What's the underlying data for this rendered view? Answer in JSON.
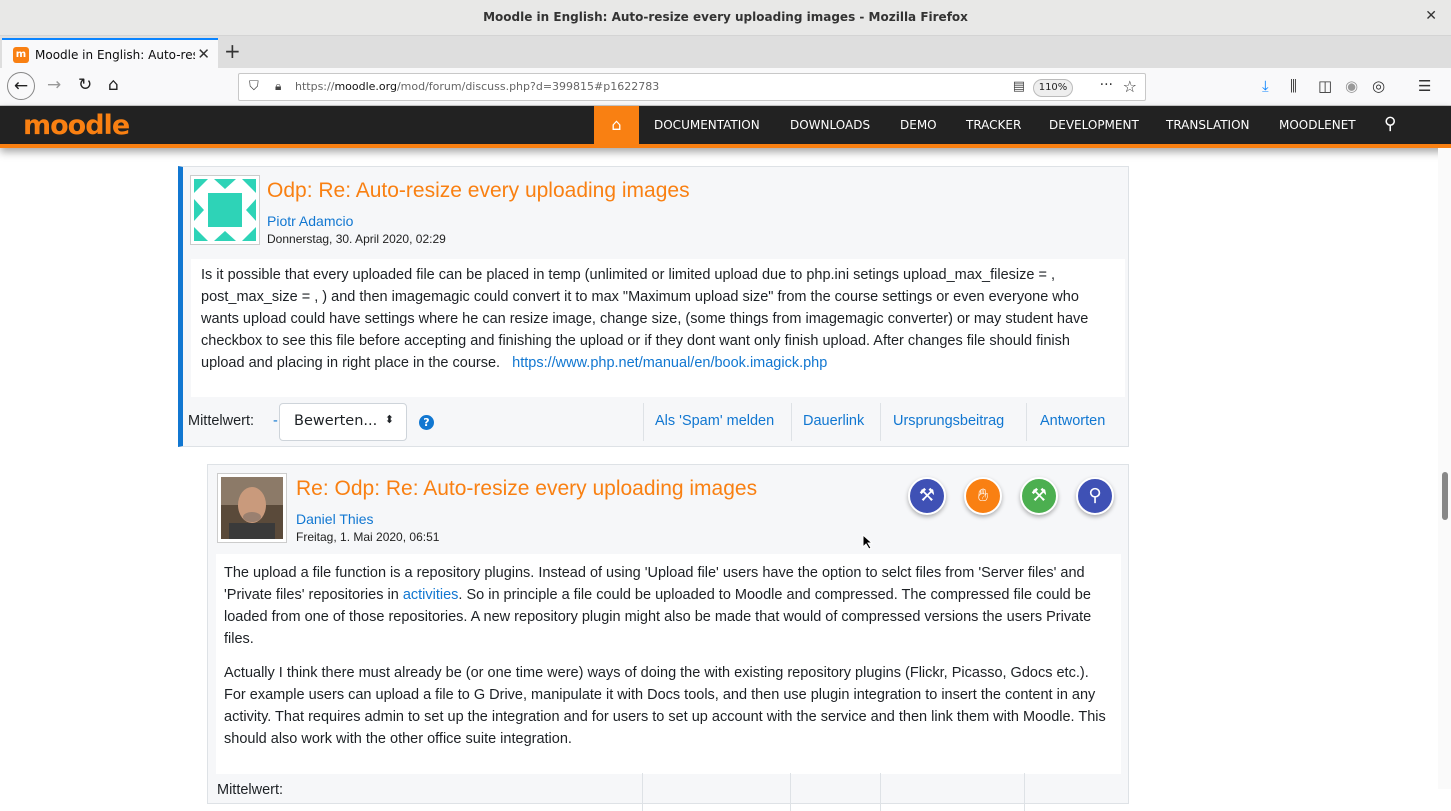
{
  "browser": {
    "window_title": "Moodle in English: Auto-resize every uploading images - Mozilla Firefox",
    "tab_label": "Moodle in English: Auto-resize every uploading images",
    "url_prefix": "https://",
    "url_domain": "moodle.org",
    "url_path": "/mod/forum/discuss.php?d=399815#p1622783",
    "zoom": "110%"
  },
  "site": {
    "logo": "moodle",
    "nav": [
      "DOCUMENTATION",
      "DOWNLOADS",
      "DEMO",
      "TRACKER",
      "DEVELOPMENT",
      "TRANSLATION",
      "MOODLENET"
    ],
    "accent_color": "#f98012",
    "link_color": "#1177d1"
  },
  "posts": [
    {
      "title": "Odp: Re: Auto-resize every uploading images",
      "author": "Piotr Adamcio",
      "date": "Donnerstag, 30. April 2020, 02:29",
      "body_text": "Is it possible that every uploaded file can be placed in temp (unlimited or limited upload due to php.ini setings upload_max_filesize = , post_max_size = , ) and then imagemagic could convert it to max \"Maximum upload size\" from the course settings or even everyone who wants upload could have settings where he can resize image, change size, (some things from imagemagic converter) or may student have checkbox to see this file before accepting and finishing the upload or if they dont want only finish upload. After changes file  should finish upload and placing in right place in  the course.",
      "body_link": "https://www.php.net/manual/en/book.imagick.php",
      "rating_label": "Mittelwert:",
      "rating_value": "-",
      "rating_select": "Bewerten...",
      "actions": [
        "Als 'Spam' melden",
        "Dauerlink",
        "Ursprungsbeitrag",
        "Antworten"
      ]
    },
    {
      "title": "Re: Odp: Re: Auto-resize every uploading images",
      "author": "Daniel Thies",
      "date": "Freitag, 1. Mai 2020, 06:51",
      "para1_a": "The upload a file function is a repository plugins. Instead of using 'Upload file' users have the option to selct files from 'Server files' and 'Private files' repositories in ",
      "para1_link": "activities",
      "para1_b": ". So in principle a file could be uploaded to Moodle and compressed. The compressed file could be loaded from one of those repositories. A new repository plugin might also be made that would of compressed versions the users Private files.",
      "para2": "Actually I think there must already be (or one time were) ways of doing the with existing repository plugins (Flickr, Picasso, Gdocs etc.).  For example users can upload a file to G Drive, manipulate it with Docs tools, and then use plugin integration to insert the content in any activity. That requires admin to set up the integration and for users to set up account with the service and then link them with Moodle. This should also work with the other office suite integration.",
      "footer_partial": "Mittelwert:",
      "badges": [
        {
          "icon": "hammer-icon",
          "color": "#3f51b5"
        },
        {
          "icon": "hand-icon",
          "color": "#f98012"
        },
        {
          "icon": "hammer-green-icon",
          "color": "#4caf50"
        },
        {
          "icon": "user-search-icon",
          "color": "#3f51b5"
        }
      ]
    }
  ]
}
